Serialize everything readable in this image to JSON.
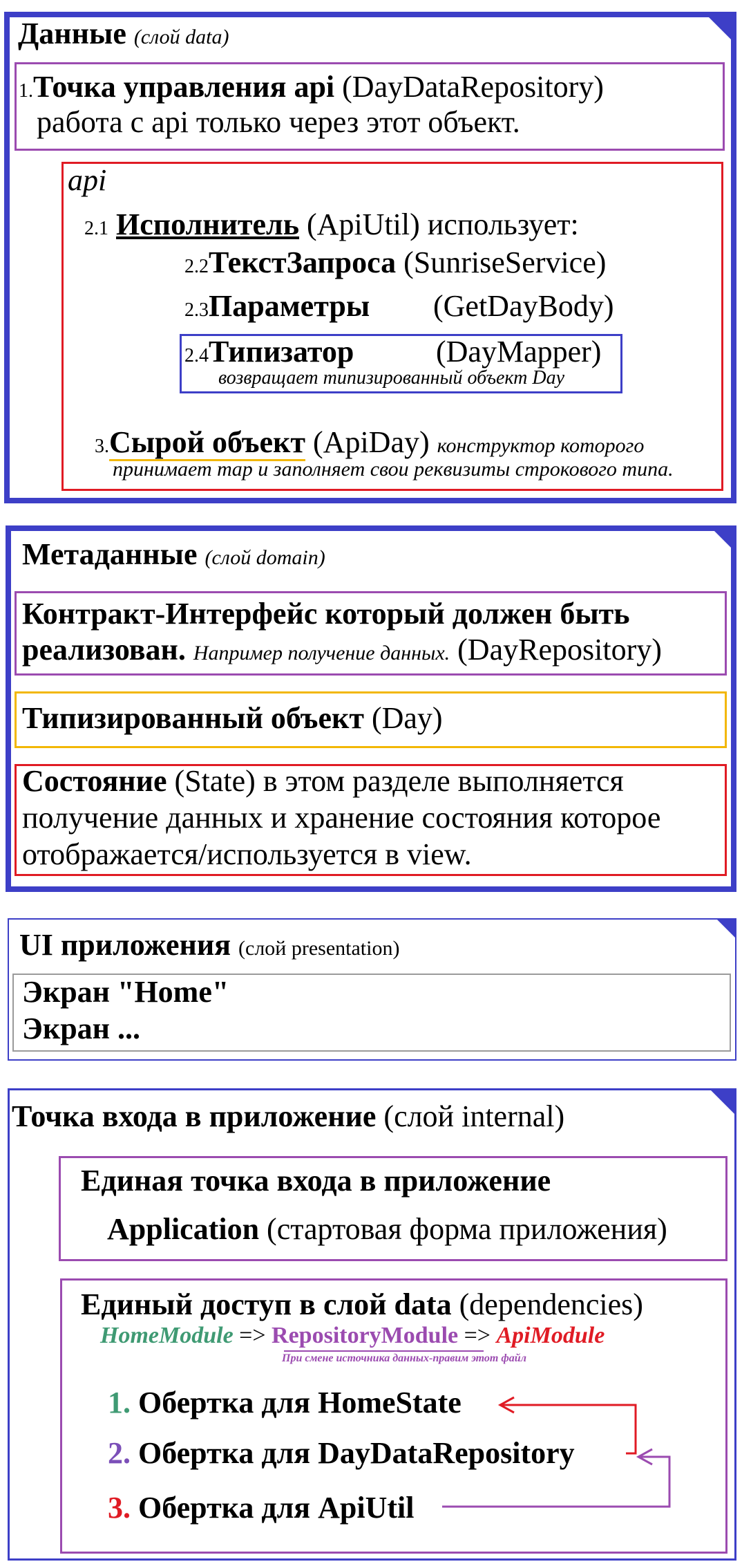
{
  "colors": {
    "blue": "#3d3fc7",
    "purple": "#9b4bb0",
    "red": "#e01b24",
    "yellow": "#f2b705",
    "gray": "#9a9a9a",
    "green": "#3f9a73",
    "arrow_red": "#e01b24",
    "arrow_purple": "#9b4bb0"
  },
  "data_layer": {
    "title": "Данные",
    "subtitle": "(слой data)",
    "point": {
      "num": "1.",
      "bold": "Точка управления api",
      "paren": "(DayDataRepository)",
      "line2": "работа с api только через этот объект."
    },
    "api_title": "api",
    "executor": {
      "num": "2.1",
      "bold": "Исполнитель",
      "rest": "(ApiUtil) использует:"
    },
    "query": {
      "num": "2.2",
      "bold": "ТекстЗапроса",
      "rest": "(SunriseService)"
    },
    "params": {
      "num": "2.3",
      "bold": "Параметры",
      "rest": "(GetDayBody)"
    },
    "typer": {
      "num": "2.4",
      "bold": "Типизатор",
      "rest": "(DayMapper)",
      "note": "возвращает типизированный объект Day"
    },
    "raw": {
      "num": "3.",
      "bold": "Сырой объект",
      "rest": "(ApiDay)",
      "note1": "конструктор которого",
      "note2": "принимает map и заполняет свои реквизиты строкового типа."
    }
  },
  "domain_layer": {
    "title": "Метаданные",
    "subtitle": "(слой domain)",
    "contract_line1": "Контракт-Интерфейс который должен быть",
    "contract_bold2": "реализован.",
    "contract_note": "Например получение данных.",
    "contract_paren": "(DayRepository)",
    "typed_bold": "Типизированный объект",
    "typed_paren": "(Day)",
    "state_bold": "Состояние",
    "state_rest": "(State) в этом разделе выполняется",
    "state_line2": "получение данных и хранение состояния которое",
    "state_line3": "отображается/используется в view."
  },
  "ui_layer": {
    "title": "UI приложения",
    "subtitle": "(слой presentation)",
    "screen1": "Экран \"Home\"",
    "screen2": "Экран ..."
  },
  "internal_layer": {
    "title": "Точка входа в приложение",
    "subtitle": "(слой internal)",
    "entry_title": "Единая точка входа в приложение",
    "app_bold": "Application",
    "app_rest": "(стартовая форма приложения)",
    "deps_bold": "Единый доступ в слой data",
    "deps_rest": "(dependencies)",
    "home_module": "HomeModule",
    "arrow1": "=>",
    "repo_module": "RepositoryModule",
    "arrow2": "=>",
    "api_module": "ApiModule",
    "hint": "При смене источника данных-правим этот файл",
    "wrap1_num": "1.",
    "wrap1": "Обертка для HomeState",
    "wrap2_num": "2.",
    "wrap2": "Обертка для DayDataRepository",
    "wrap3_num": "3.",
    "wrap3": "Обертка для ApiUtil"
  }
}
